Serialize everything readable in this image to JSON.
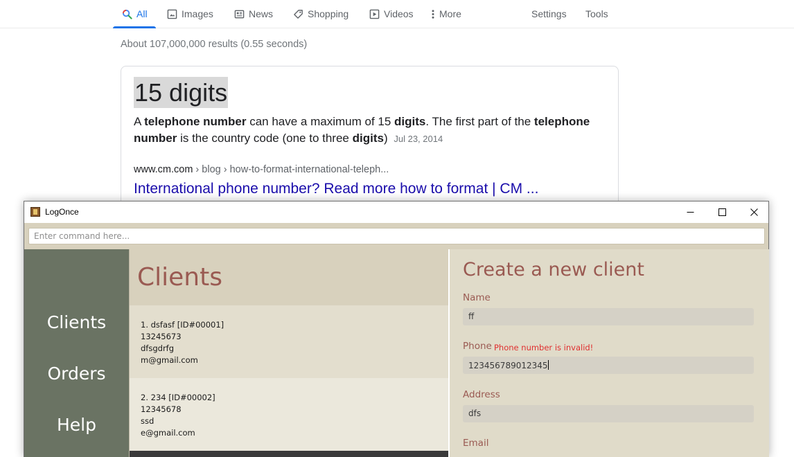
{
  "search_tabs": [
    {
      "label": "All",
      "icon": "search-icon",
      "active": true
    },
    {
      "label": "Images",
      "icon": "image-icon"
    },
    {
      "label": "News",
      "icon": "news-icon"
    },
    {
      "label": "Shopping",
      "icon": "tag-icon"
    },
    {
      "label": "Videos",
      "icon": "video-icon"
    },
    {
      "label": "More",
      "icon": "more-vertical-icon"
    }
  ],
  "search_tools": {
    "settings": "Settings",
    "tools": "Tools"
  },
  "result_stats": "About 107,000,000 results (0.55 seconds)",
  "featured_snippet": {
    "answer": "15 digits",
    "text_parts": [
      "A ",
      "telephone number",
      " can have a maximum of 15 ",
      "digits",
      ". The first part of the ",
      "telephone number",
      " is the country code (one to three ",
      "digits",
      ")"
    ],
    "date": "Jul 23, 2014",
    "cite_domain": "www.cm.com",
    "cite_path": " › blog › how-to-format-international-teleph...",
    "link_title": "International phone number? Read more how to format | CM ..."
  },
  "app": {
    "title": "LogOnce",
    "command_placeholder": "Enter command here...",
    "nav": [
      "Clients",
      "Orders",
      "Help"
    ],
    "clients_title": "Clients",
    "clients": [
      {
        "header": "1.   dsfasf [ID#00001]",
        "phone": "13245673",
        "address": "dfsgdrfg",
        "email": "m@gmail.com"
      },
      {
        "header": "2.   234 [ID#00002]",
        "phone": "12345678",
        "address": "ssd",
        "email": "e@gmail.com"
      }
    ],
    "form": {
      "title": "Create a new client",
      "name_label": "Name",
      "name_value": "ff",
      "phone_label": "Phone",
      "phone_error": "Phone number is invalid!",
      "phone_value": "123456789012345",
      "address_label": "Address",
      "address_value": "dfs",
      "email_label": "Email"
    }
  },
  "colors": {
    "google_blue": "#1a73e8",
    "link": "#1a0dab",
    "sidebar": "#6a7363",
    "accent_title": "#9a5a52",
    "error": "#e03030"
  }
}
